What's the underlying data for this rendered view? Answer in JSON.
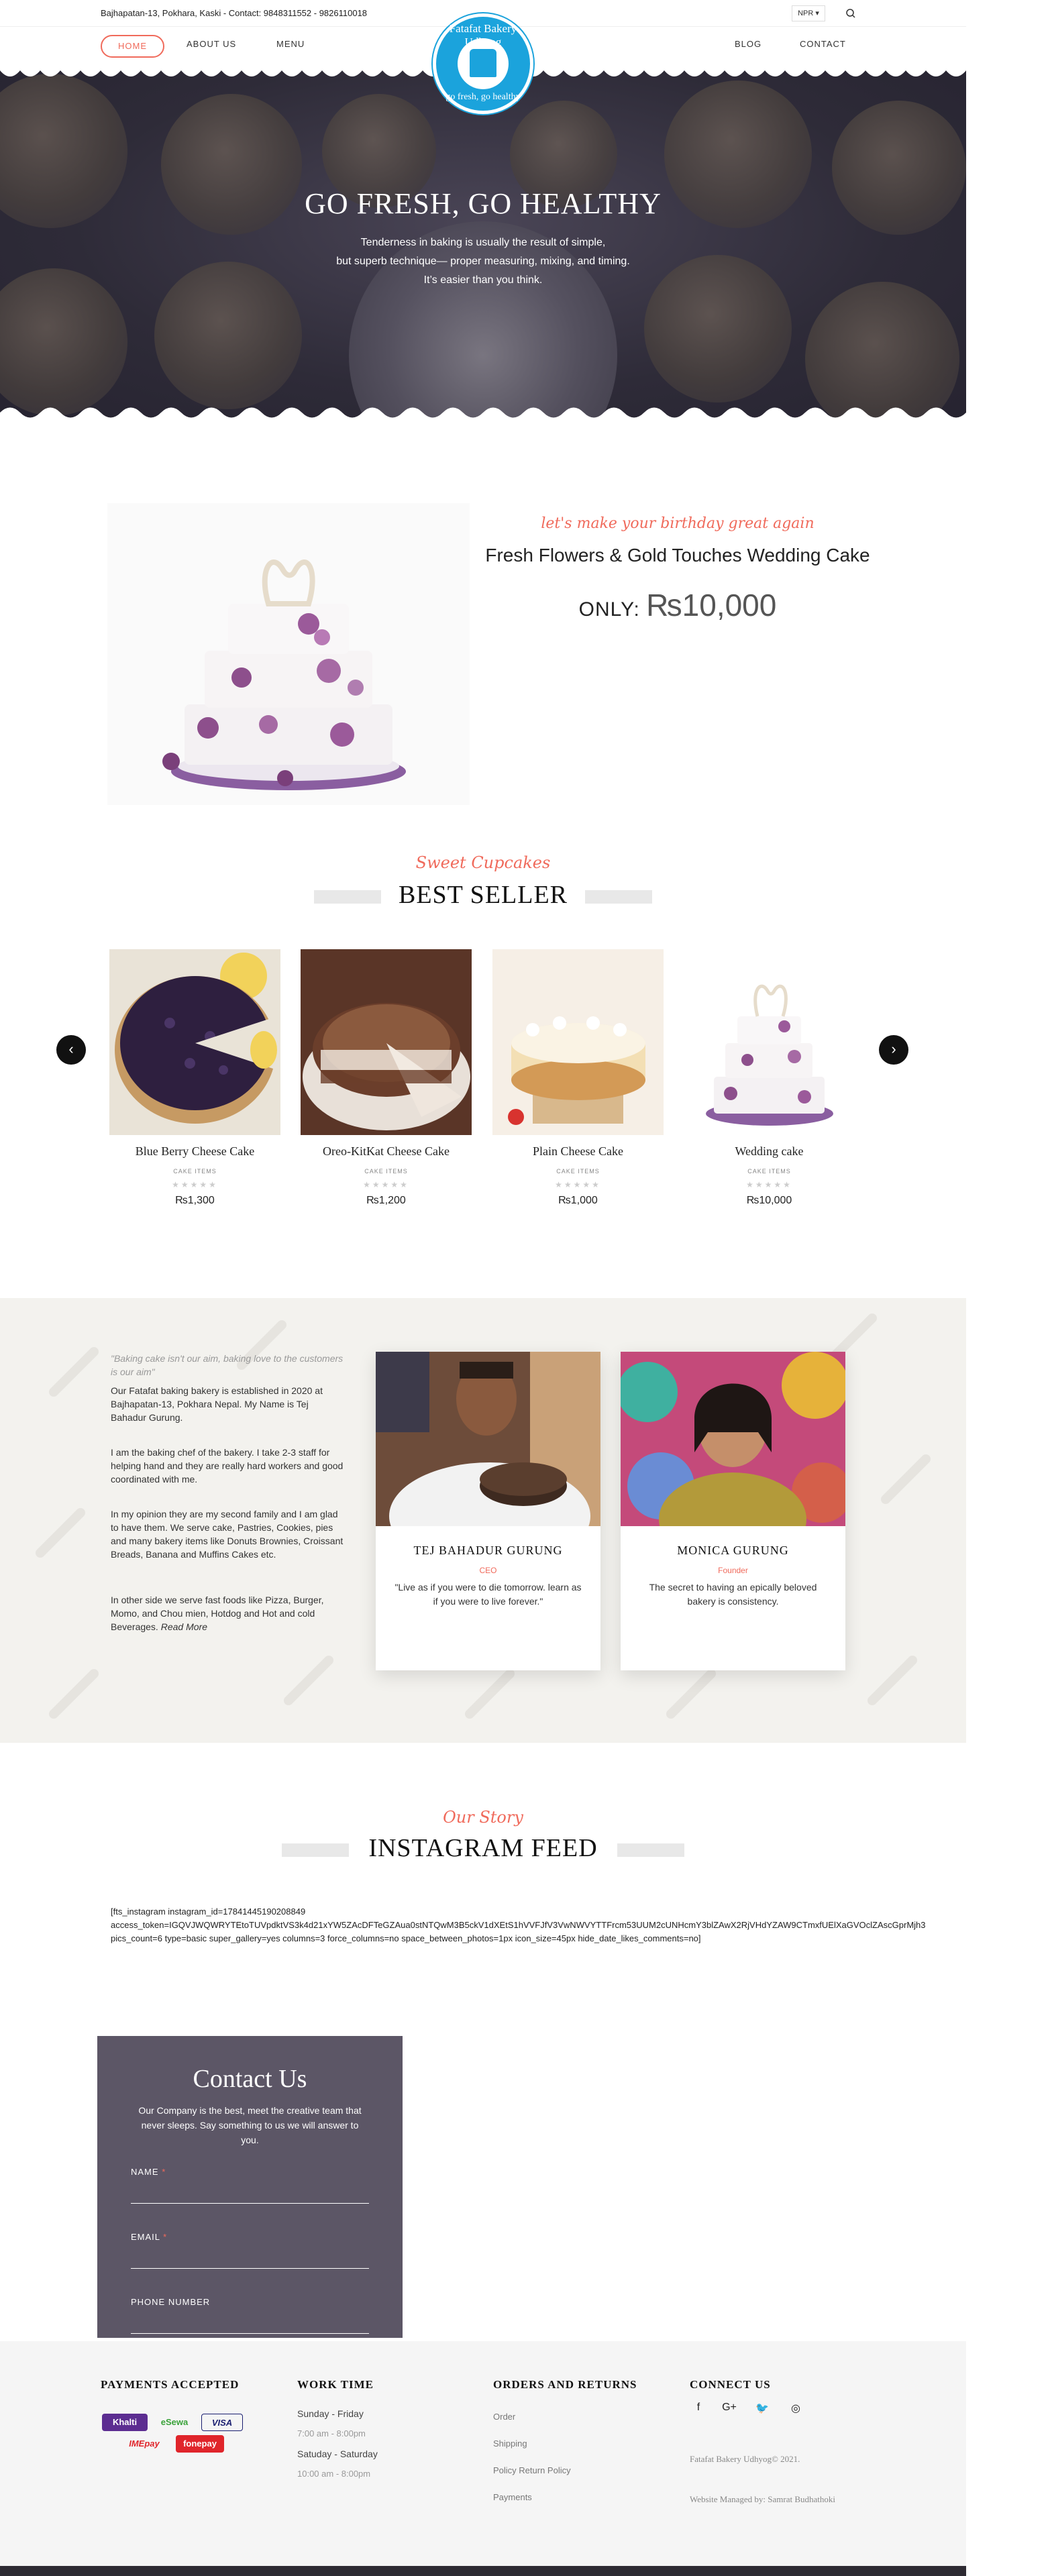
{
  "topbar": {
    "info": "Bajhapatan-13, Pokhara, Kaski - Contact: 9848311552 - 9826110018",
    "currency": "NPR ▾",
    "search_icon": "search-icon"
  },
  "nav": {
    "home": "HOME",
    "about": "ABOUT US",
    "menu": "MENU",
    "blog": "BLOG",
    "contact": "CONTACT"
  },
  "logo": {
    "line1": "Fatafat Bakery Udhyog",
    "line2": "go fresh, go healthy"
  },
  "hero": {
    "title": "GO FRESH, GO HEALTHY",
    "line1": "Tenderness in baking is usually the result of simple,",
    "line2": "but superb technique— proper measuring, mixing, and timing.",
    "line3": "It’s easier than you think."
  },
  "feature": {
    "tagline": "let's make your birthday great again",
    "title": "Fresh Flowers & Gold Touches Wedding Cake",
    "price_label": "ONLY: ",
    "price_value": "₨10,000"
  },
  "bestseller": {
    "tag": "Sweet Cupcakes",
    "title": "BEST SELLER",
    "prev": "‹",
    "next": "›",
    "products": [
      {
        "name": "Blue Berry Cheese Cake",
        "category": "CAKE ITEMS",
        "stars": "★★★★★",
        "price": "₨1,300"
      },
      {
        "name": "Oreo-KitKat Cheese Cake",
        "category": "CAKE ITEMS",
        "stars": "★★★★★",
        "price": "₨1,200"
      },
      {
        "name": "Plain Cheese Cake",
        "category": "CAKE ITEMS",
        "stars": "★★★★★",
        "price": "₨1,000"
      },
      {
        "name": "Wedding cake",
        "category": "CAKE ITEMS",
        "stars": "★★★★★",
        "price": "₨10,000"
      }
    ]
  },
  "about": {
    "quote": "\"Baking cake isn't our aim, baking love to the customers is our aim\"",
    "p1": "Our Fatafat baking bakery is established in 2020 at Bajhapatan-13, Pokhara Nepal. My Name is Tej Bahadur Gurung.",
    "p2": "I am the baking chef of the bakery. I take 2-3 staff for helping hand and they are really hard workers and good coordinated with me.",
    "p3": "In my opinion they are my second family and I am glad to have them. We serve cake, Pastries, Cookies, pies and many bakery items like Donuts Brownies, Croissant Breads, Banana and Muffins Cakes etc.",
    "p4": "In other side we serve fast foods like Pizza, Burger, Momo, and Chou mien, Hotdog and Hot and cold Beverages.",
    "read_more": "Read More",
    "people": [
      {
        "name": "TEJ BAHADUR GURUNG",
        "role": "CEO",
        "quote": "\"Live as if you were to die tomorrow. learn as if you were to live forever.\""
      },
      {
        "name": "MONICA GURUNG",
        "role": "Founder",
        "quote": "The secret to having an epically beloved bakery is consistency."
      }
    ]
  },
  "instagram": {
    "tag": "Our Story",
    "title": "INSTAGRAM FEED",
    "shortcode_l1": "[fts_instagram instagram_id=17841445190208849",
    "shortcode_l2": "access_token=IGQVJWQWRYTEtoTUVpdktVS3k4d21xYW5ZAcDFTeGZAua0stNTQwM3B5ckV1dXEtS1hVVFJfV3VwNWVYTTFrcm53UUM2cUNHcmY3blZAwX2RjVHdYZAW9CTmxfUElXaGVOclZAscGprMjh3",
    "shortcode_l3": "pics_count=6 type=basic super_gallery=yes columns=3 force_columns=no space_between_photos=1px icon_size=45px hide_date_likes_comments=no]"
  },
  "contact": {
    "title": "Contact Us",
    "desc": "Our Company is the best, meet the creative team that never sleeps. Say something to us we will answer to you.",
    "name_label": "NAME",
    "email_label": "EMAIL",
    "phone_label": "PHONE NUMBER",
    "required": "*"
  },
  "footer": {
    "payments_title": "PAYMENTS ACCEPTED",
    "pay_khalti": "Khalti",
    "pay_esewa": "eSewa",
    "pay_visa": "VISA",
    "pay_imepay": "IMEpay",
    "pay_fonepay": "fonepay",
    "work_title": "WORK TIME",
    "work_l1": "Sunday - Friday",
    "work_l2": "7:00 am - 8:00pm",
    "work_l3": "Satuday - Saturday",
    "work_l4": "10:00 am - 8:00pm",
    "orders_title": "ORDERS AND RETURNS",
    "orders_links": [
      "Order",
      "Shipping",
      "Policy Return Policy",
      "Payments"
    ],
    "connect_title": "CONNECT US",
    "social": [
      "f",
      "G+",
      "🐦",
      "◎"
    ],
    "copyright": "Fatafat Bakery Udhyog© 2021.",
    "managed": "Website Managed by: Samrat Budhathoki"
  },
  "colors": {
    "accent": "#f06a5b",
    "brand_blue": "#1ba3dc",
    "hero_dark": "#2e2b38",
    "contact_bg": "#5c5666"
  }
}
